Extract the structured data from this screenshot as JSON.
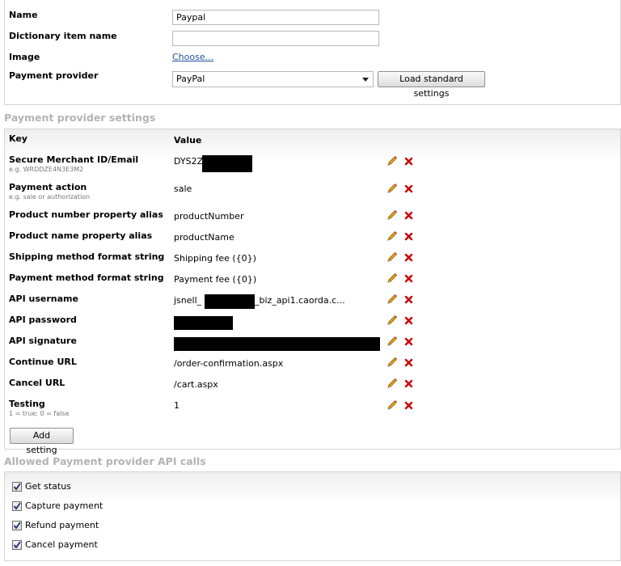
{
  "general": {
    "name_label": "Name",
    "name_value": "Paypal",
    "dict_label": "Dictionary item name",
    "dict_value": "",
    "image_label": "Image",
    "image_link": "Choose...",
    "provider_label": "Payment provider",
    "provider_selected": "PayPal",
    "load_button": "Load standard settings"
  },
  "settings": {
    "title": "Payment provider settings",
    "key_header": "Key",
    "value_header": "Value",
    "rows": [
      {
        "key": "Secure Merchant ID/Email",
        "hint": "e.g. WRDDZE4N3E3M2",
        "value": "DYS2Z"
      },
      {
        "key": "Payment action",
        "hint": "e.g. sale or authorization",
        "value": "sale"
      },
      {
        "key": "Product number property alias",
        "hint": "",
        "value": "productNumber"
      },
      {
        "key": "Product name property alias",
        "hint": "",
        "value": "productName"
      },
      {
        "key": "Shipping method format string",
        "hint": "",
        "value": "Shipping fee ({0})"
      },
      {
        "key": "Payment method format string",
        "hint": "",
        "value": "Payment fee ({0})"
      },
      {
        "key": "API username",
        "hint": "",
        "value": "jsnell_",
        "value2": "_biz_api1.caorda.c..."
      },
      {
        "key": "API password",
        "hint": "",
        "value": ""
      },
      {
        "key": "API signature",
        "hint": "",
        "value": ""
      },
      {
        "key": "Continue URL",
        "hint": "",
        "value": "/order-confirmation.aspx"
      },
      {
        "key": "Cancel URL",
        "hint": "",
        "value": "/cart.aspx"
      },
      {
        "key": "Testing",
        "hint": "1 = true; 0 = false",
        "value": "1"
      }
    ],
    "add_button": "Add setting"
  },
  "api_calls": {
    "title": "Allowed Payment provider API calls",
    "items": [
      {
        "label": "Get status",
        "checked": true
      },
      {
        "label": "Capture payment",
        "checked": true
      },
      {
        "label": "Refund payment",
        "checked": true
      },
      {
        "label": "Cancel payment",
        "checked": true
      }
    ]
  },
  "colors": {
    "link": "#1f4f9e",
    "section_title": "#b3b3b3",
    "delete_icon": "#cc0000",
    "edit_icon": "#e7a522"
  },
  "icons": {
    "edit": "pencil-icon",
    "delete": "delete-x-icon",
    "dropdown": "chevron-down-icon",
    "checkbox": "checkmark-icon"
  }
}
